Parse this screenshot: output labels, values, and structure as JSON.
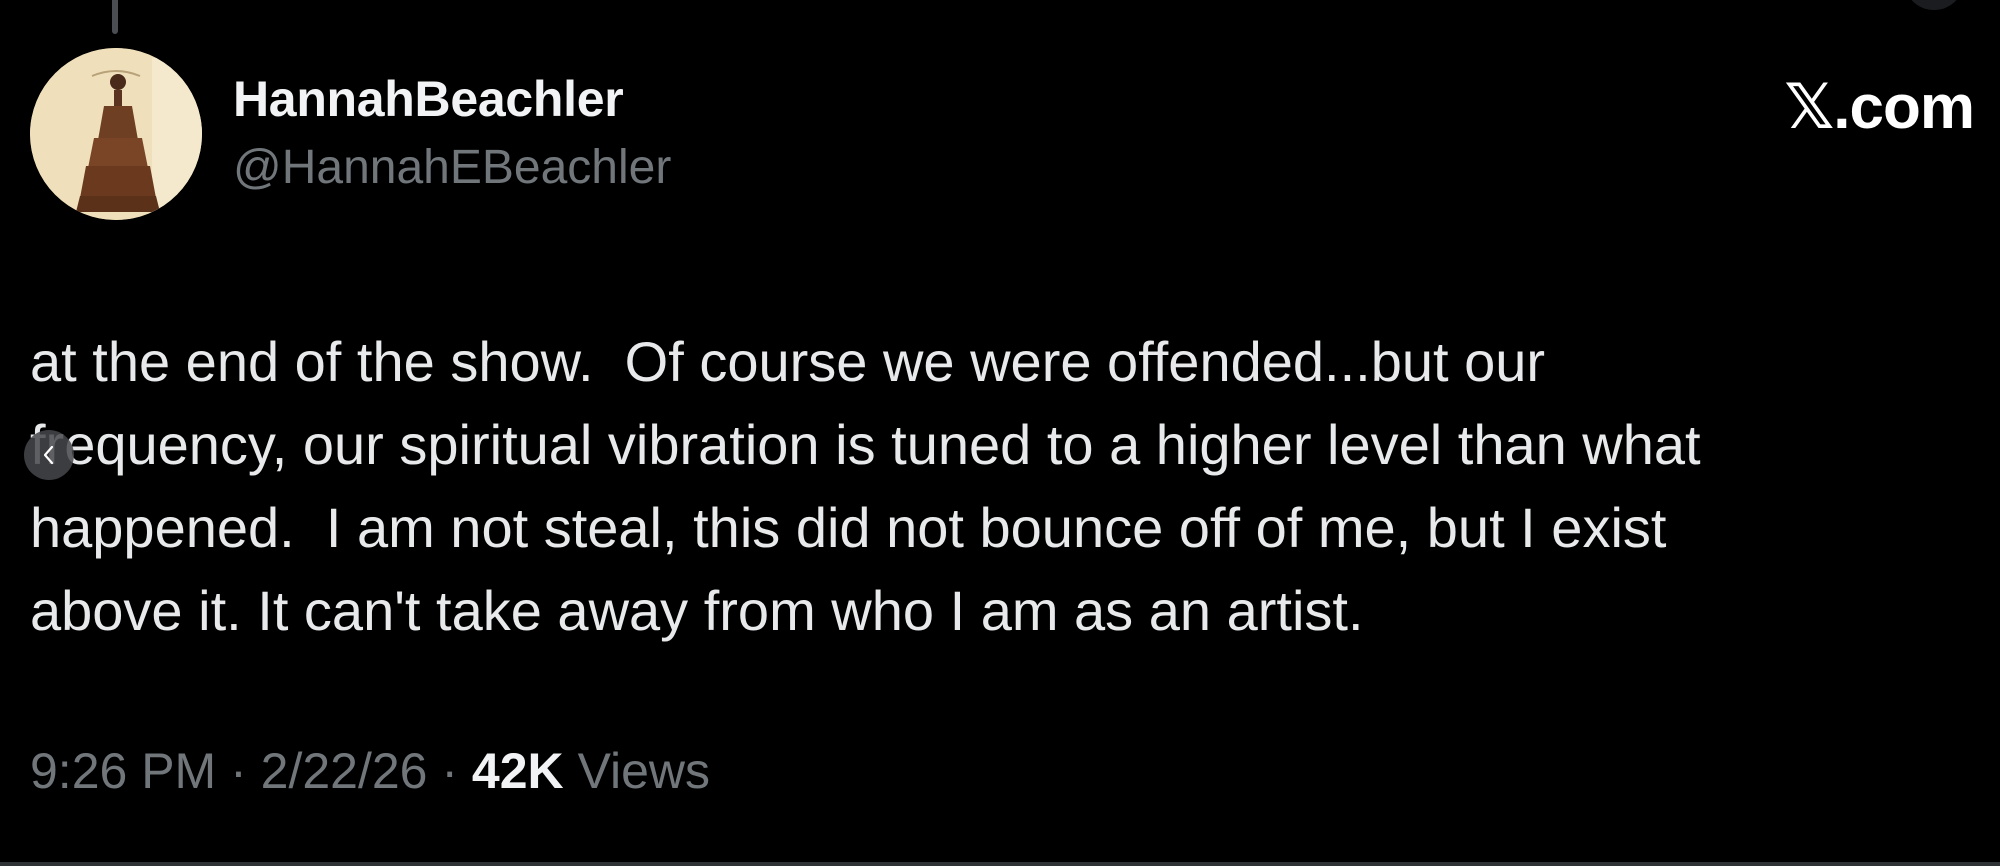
{
  "author": {
    "display_name": "HannahBeachler",
    "handle": "@HannahEBeachler",
    "avatar_icon": "profile-photo"
  },
  "brand": {
    "label": "𝕏.com"
  },
  "tweet": {
    "text": "at the end of the show.  Of course we were offended...but our\nfrequency, our spiritual vibration is tuned to a higher level than what\nhappened.  I am not steal, this did not bounce off of me, but I exist\nabove it. It can't take away from who I am as an artist."
  },
  "meta": {
    "time": "9:26 PM",
    "separator": " · ",
    "date": "2/22/26",
    "views_count": "42K",
    "views_label": "Views"
  },
  "navigation": {
    "prev_icon": "chevron-left-icon"
  },
  "colors": {
    "background": "#000000",
    "primary_text": "#e7e9ea",
    "secondary_text": "#71767b"
  }
}
